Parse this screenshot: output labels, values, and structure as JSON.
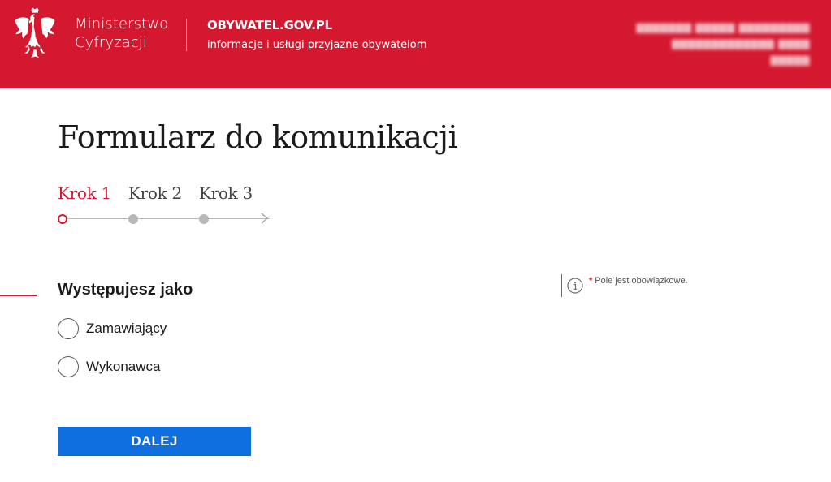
{
  "header": {
    "ministry_line1": "Ministerstwo",
    "ministry_line2": "Cyfryzacji",
    "portal_name": "OBYWATEL.GOV.PL",
    "portal_tagline": "informacje i usługi przyjazne obywatelom",
    "logo_icon": "polish-eagle-emblem",
    "colors": {
      "background": "#d4182f",
      "text": "#ffffff"
    }
  },
  "page": {
    "title": "Formularz do komunikacji"
  },
  "stepper": {
    "steps": [
      {
        "label": "Krok 1",
        "active": true
      },
      {
        "label": "Krok 2",
        "active": false
      },
      {
        "label": "Krok 3",
        "active": false
      }
    ],
    "active_color": "#d4182f",
    "arrow_icon": "chevron-right-icon"
  },
  "form": {
    "section_title": "Występujesz jako",
    "options": [
      {
        "label": "Zamawiający",
        "selected": false
      },
      {
        "label": "Wykonawca",
        "selected": false
      }
    ],
    "required_note": {
      "star": "*",
      "text": "Pole jest obowiązkowe.",
      "icon": "info-icon"
    },
    "next_button": "DALEJ",
    "button_color": "#0f6fe0"
  }
}
